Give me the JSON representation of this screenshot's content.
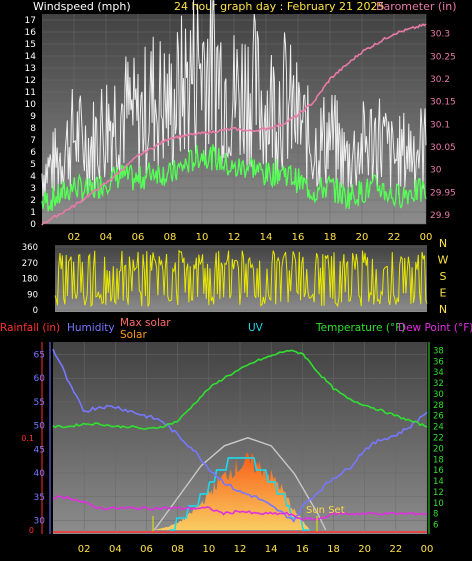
{
  "header": {
    "windspeed_label": "Windspeed (mph)",
    "title": "24 hour graph day : February 21 2025",
    "barometer_label": "Barometer (in)"
  },
  "colors": {
    "background": "#000000",
    "plot_top": "#4a4a4a",
    "plot_bottom": "#8a8a8a",
    "wind_speed": "#f0f0f0",
    "wind_avg": "#55ff55",
    "barometer": "#e87aa8",
    "direction": "#e8e800",
    "rain": "#ff3030",
    "humidity": "#7777ff",
    "max_solar": "#c8c8c8",
    "solar": "#ff8c1a",
    "uv": "#20d8e8",
    "temperature": "#30e030",
    "dew_point": "#e030e0"
  },
  "chart_data": [
    {
      "type": "line",
      "panel": "wind-barometer",
      "x_ticks": [
        "02",
        "04",
        "06",
        "08",
        "10",
        "12",
        "14",
        "16",
        "18",
        "20",
        "22",
        "00"
      ],
      "y_left": {
        "label": "Windspeed (mph)",
        "ticks": [
          "0",
          "1",
          "2",
          "3",
          "4",
          "5",
          "6",
          "7",
          "8",
          "9",
          "10",
          "11",
          "12",
          "13",
          "14",
          "15",
          "16",
          "17"
        ],
        "range": [
          0,
          17
        ]
      },
      "y_right": {
        "label": "Barometer (in)",
        "ticks": [
          "29.9",
          "29.95",
          "30",
          "30.05",
          "30.1",
          "30.15",
          "30.2",
          "30.25",
          "30.3"
        ],
        "range": [
          29.88,
          30.33
        ]
      },
      "series": [
        {
          "name": "Windspeed (mph)",
          "x": [
            0,
            1,
            2,
            3,
            4,
            5,
            6,
            7,
            8,
            9,
            10,
            11,
            12,
            13,
            14,
            15,
            16,
            17,
            18,
            19,
            20,
            21,
            22,
            23,
            24
          ],
          "y": [
            4,
            5,
            7,
            6,
            8,
            9,
            8,
            10,
            9,
            11,
            13,
            12,
            10,
            11,
            9,
            10,
            8,
            6,
            7,
            5,
            6,
            7,
            5,
            6,
            6
          ]
        },
        {
          "name": "Barometer (in)",
          "x": [
            0,
            2,
            4,
            6,
            8,
            10,
            12,
            13,
            14,
            15,
            16,
            17,
            18,
            19,
            20,
            21,
            22,
            23,
            24
          ],
          "y": [
            29.88,
            29.92,
            29.97,
            30.03,
            30.07,
            30.08,
            30.09,
            30.085,
            30.09,
            30.1,
            30.12,
            30.15,
            30.2,
            30.23,
            30.26,
            30.28,
            30.3,
            30.31,
            30.32
          ]
        }
      ]
    },
    {
      "type": "line",
      "panel": "wind-direction",
      "y_ticks": [
        "360",
        "270",
        "180",
        "90",
        "0"
      ],
      "compass": [
        "N",
        "W",
        "S",
        "E",
        "N"
      ],
      "y_range": [
        0,
        360
      ]
    },
    {
      "type": "line",
      "panel": "multi",
      "legend": [
        "Rainfall (in)",
        "Humidity",
        "Max solar",
        "Solar",
        "UV",
        "Temperature (°F)",
        "Dew Point (°F)"
      ],
      "annotation": "Sun Set",
      "rain_ticks": [
        "0.1",
        "0"
      ],
      "humidity_ticks": [
        "65",
        "60",
        "55",
        "50",
        "45",
        "40",
        "35",
        "30"
      ],
      "temp_ticks": [
        "38",
        "36",
        "34",
        "32",
        "30",
        "28",
        "26",
        "24",
        "22",
        "20",
        "18",
        "16",
        "14",
        "12",
        "10",
        "8",
        "6"
      ],
      "x_ticks": [
        "02",
        "04",
        "06",
        "08",
        "10",
        "12",
        "14",
        "16",
        "18",
        "20",
        "22",
        "00"
      ],
      "series": [
        {
          "name": "Humidity",
          "x": [
            0,
            0.5,
            1,
            2,
            3,
            4,
            5,
            6,
            7,
            8,
            9,
            10,
            11,
            12,
            13,
            14,
            15,
            15.5,
            16,
            17,
            18,
            19,
            20,
            21,
            22,
            23,
            24
          ],
          "y": [
            66,
            63,
            59,
            53,
            54,
            54,
            53,
            52,
            51,
            48,
            45,
            41,
            38,
            36,
            35,
            33,
            31,
            30,
            33,
            36,
            39,
            41,
            45,
            47,
            48,
            50,
            53
          ]
        },
        {
          "name": "Temperature (°F)",
          "x": [
            0,
            1,
            2,
            3,
            4,
            5,
            6,
            7,
            8,
            9,
            10,
            11,
            12,
            13,
            14,
            15,
            16,
            17,
            18,
            19,
            20,
            21,
            22,
            23,
            24
          ],
          "y": [
            24,
            24,
            24.5,
            24.5,
            24,
            24,
            23.5,
            24,
            25,
            28,
            31,
            33,
            34.5,
            36,
            37,
            38,
            37.5,
            34,
            31,
            29,
            28,
            27,
            26,
            25,
            24
          ]
        },
        {
          "name": "Dew Point (°F)",
          "x": [
            0,
            1,
            2,
            3,
            4,
            5,
            6,
            7,
            8,
            9,
            10,
            11,
            12,
            13,
            14,
            15,
            16,
            17,
            18,
            19,
            20,
            21,
            22,
            23,
            24
          ],
          "y": [
            11,
            11,
            10,
            9,
            9,
            9,
            9,
            9,
            9,
            9,
            9,
            8,
            8.5,
            8,
            8,
            8,
            7,
            7,
            8,
            8,
            8,
            8,
            8,
            8,
            8
          ]
        },
        {
          "name": "Solar",
          "x": [
            6.5,
            7.5,
            8.5,
            9.5,
            10.5,
            11.5,
            12.5,
            13.5,
            14.5,
            15.5,
            16.5
          ],
          "y": [
            0,
            1,
            3,
            7,
            12,
            16,
            18,
            16,
            12,
            5,
            0
          ]
        },
        {
          "name": "Max solar",
          "x": [
            6.5,
            8,
            9.5,
            11,
            12.5,
            14,
            15.5,
            17,
            17.5
          ],
          "y": [
            0,
            8,
            16,
            21,
            23,
            21,
            14,
            4,
            0
          ]
        },
        {
          "name": "UV",
          "x": [
            7.5,
            8.5,
            9.5,
            10.5,
            11.5,
            12.5,
            13.5,
            14.5,
            15.5,
            16.5
          ],
          "y": [
            0,
            4,
            8,
            14,
            18,
            18,
            15,
            10,
            3,
            0
          ]
        }
      ]
    }
  ]
}
